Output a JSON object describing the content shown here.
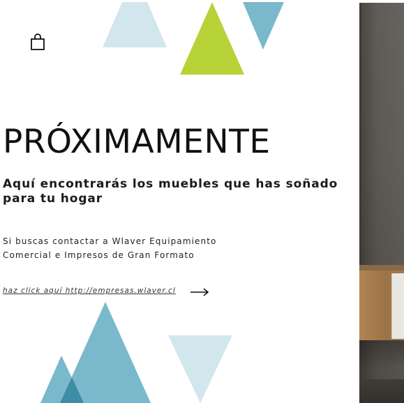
{
  "colors": {
    "light_blue": "#d2e6ee",
    "mid_blue": "#7ab8cc",
    "dark_blue": "#3e8ca6",
    "lime_green": "#b8d338",
    "text": "#111111"
  },
  "header": {
    "cart_icon": "shopping-bag-icon"
  },
  "main": {
    "headline": "PRÓXIMAMENTE",
    "subtitle": "Aquí encontrarás los muebles que has soñado para tu hogar",
    "body_line_1": "Si buscas contactar a Wlaver Equipamiento",
    "body_line_2": "Comercial e Impresos de Gran Formato",
    "link_text": "haz click aquí http://empresas.wlaver.cl",
    "link_arrow_icon": "arrow-right-icon"
  }
}
